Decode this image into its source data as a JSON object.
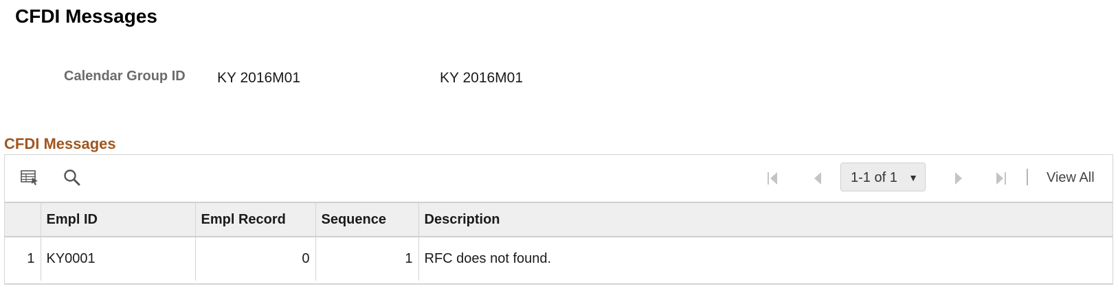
{
  "page": {
    "title": "CFDI Messages"
  },
  "calendar_group": {
    "label": "Calendar Group ID",
    "value": "KY 2016M01",
    "description": "KY 2016M01"
  },
  "grid": {
    "title": "CFDI Messages",
    "icons": {
      "personalize": "grid-personalize-icon",
      "find": "search-icon",
      "first": "first-page-icon",
      "previous": "previous-page-icon",
      "next": "next-page-icon",
      "last": "last-page-icon"
    },
    "pagination": {
      "selected": "1-1 of 1"
    },
    "view_all_label": "View All",
    "columns": [
      "Empl ID",
      "Empl Record",
      "Sequence",
      "Description"
    ],
    "rows": [
      {
        "index": "1",
        "empl_id": "KY0001",
        "empl_record": "0",
        "sequence": "1",
        "description": "RFC does not found."
      }
    ]
  },
  "colors": {
    "section_title": "#a0561f",
    "label_gray": "#6b6b6b",
    "header_bg": "#efefef",
    "border": "#d4d4d4"
  }
}
